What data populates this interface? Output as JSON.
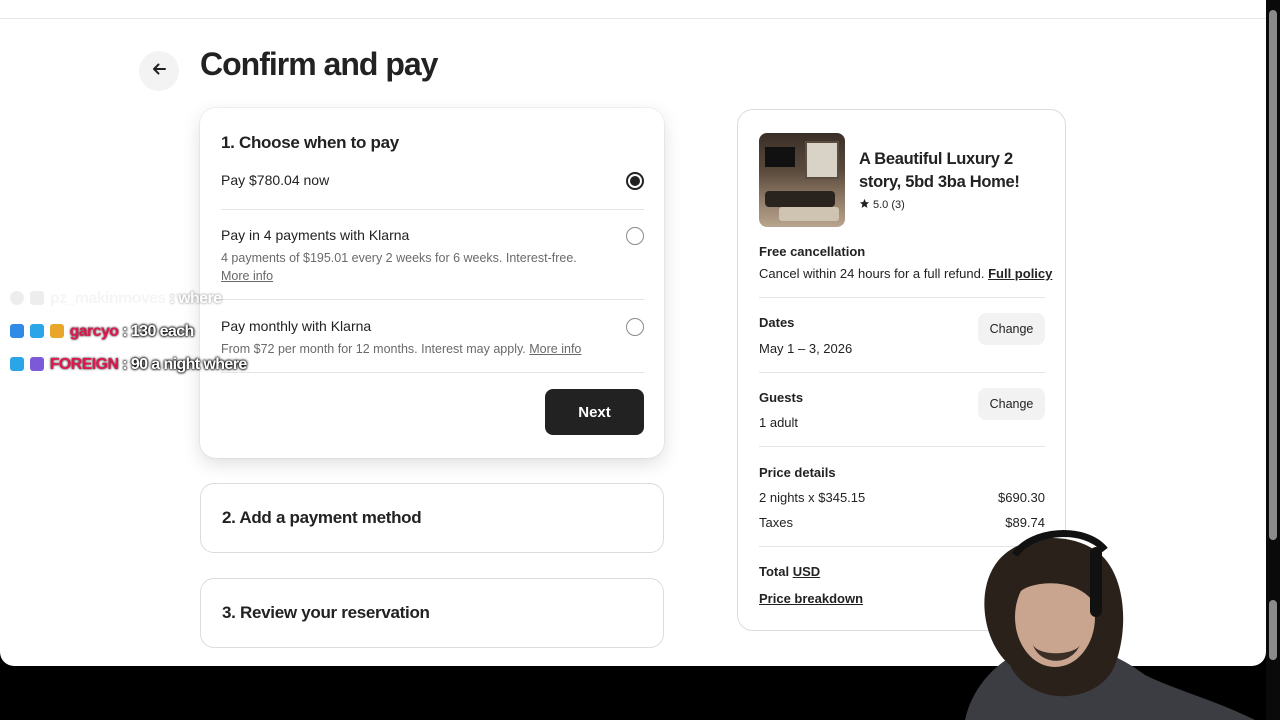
{
  "page": {
    "title": "Confirm and pay"
  },
  "step1": {
    "heading": "1. Choose when to pay",
    "options": [
      {
        "title": "Pay $780.04 now",
        "subtitle": "",
        "link": "",
        "selected": true
      },
      {
        "title": "Pay in 4 payments with Klarna",
        "subtitle": "4 payments of $195.01 every 2 weeks for 6 weeks. Interest-free.",
        "link": "More info",
        "selected": false
      },
      {
        "title": "Pay monthly with Klarna",
        "subtitle": "From $72 per month for 12 months. Interest may apply.",
        "link": "More info",
        "selected": false
      }
    ],
    "next_label": "Next"
  },
  "step2": {
    "heading": "2. Add a payment method"
  },
  "step3": {
    "heading": "3. Review your reservation"
  },
  "listing": {
    "title": "A Beautiful Luxury 2 story, 5bd 3ba Home!",
    "rating": "5.0 (3)"
  },
  "cancellation": {
    "label": "Free cancellation",
    "text": "Cancel within 24 hours for a full refund.",
    "link": "Full policy"
  },
  "dates": {
    "label": "Dates",
    "value": "May 1 – 3, 2026",
    "change": "Change"
  },
  "guests": {
    "label": "Guests",
    "value": "1 adult",
    "change": "Change"
  },
  "price_details": {
    "label": "Price details",
    "rows": [
      {
        "label": "2 nights x $345.15",
        "value": "$690.30"
      },
      {
        "label": "Taxes",
        "value": "$89.74"
      }
    ],
    "total_label": "Total",
    "currency": "USD",
    "breakdown_link": "Price breakdown"
  },
  "chat": [
    {
      "user": "pz_makinmoves",
      "message": ": where",
      "user_color": "#d9d9d9",
      "faded": true
    },
    {
      "user": "garcyo",
      "message": ": 130 each",
      "user_color": "#e0174f",
      "faded": false
    },
    {
      "user": "FOREIGN",
      "message": ": 90 a night where",
      "user_color": "#e0174f",
      "faded": false
    }
  ]
}
